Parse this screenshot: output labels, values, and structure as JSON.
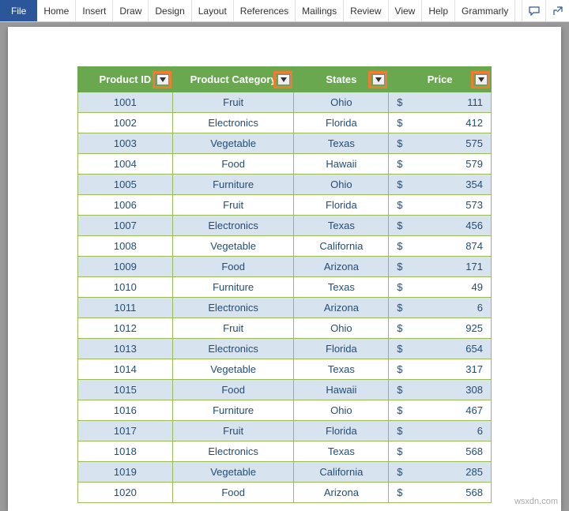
{
  "ribbon": {
    "file": "File",
    "tabs": [
      "Home",
      "Insert",
      "Draw",
      "Design",
      "Layout",
      "References",
      "Mailings",
      "Review",
      "View",
      "Help",
      "Grammarly"
    ],
    "comment_icon": "💬",
    "share_icon": "↗"
  },
  "table": {
    "headers": [
      "Product ID",
      "Product Category",
      "States",
      "Price"
    ],
    "currency": "$",
    "rows": [
      {
        "id": "1001",
        "cat": "Fruit",
        "state": "Ohio",
        "price": "111"
      },
      {
        "id": "1002",
        "cat": "Electronics",
        "state": "Florida",
        "price": "412"
      },
      {
        "id": "1003",
        "cat": "Vegetable",
        "state": "Texas",
        "price": "575"
      },
      {
        "id": "1004",
        "cat": "Food",
        "state": "Hawaii",
        "price": "579"
      },
      {
        "id": "1005",
        "cat": "Furniture",
        "state": "Ohio",
        "price": "354"
      },
      {
        "id": "1006",
        "cat": "Fruit",
        "state": "Florida",
        "price": "573"
      },
      {
        "id": "1007",
        "cat": "Electronics",
        "state": "Texas",
        "price": "456"
      },
      {
        "id": "1008",
        "cat": "Vegetable",
        "state": "California",
        "price": "874"
      },
      {
        "id": "1009",
        "cat": "Food",
        "state": "Arizona",
        "price": "171"
      },
      {
        "id": "1010",
        "cat": "Furniture",
        "state": "Texas",
        "price": "49"
      },
      {
        "id": "1011",
        "cat": "Electronics",
        "state": "Arizona",
        "price": "6"
      },
      {
        "id": "1012",
        "cat": "Fruit",
        "state": "Ohio",
        "price": "925"
      },
      {
        "id": "1013",
        "cat": "Electronics",
        "state": "Florida",
        "price": "654"
      },
      {
        "id": "1014",
        "cat": "Vegetable",
        "state": "Texas",
        "price": "317"
      },
      {
        "id": "1015",
        "cat": "Food",
        "state": "Hawaii",
        "price": "308"
      },
      {
        "id": "1016",
        "cat": "Furniture",
        "state": "Ohio",
        "price": "467"
      },
      {
        "id": "1017",
        "cat": "Fruit",
        "state": "Florida",
        "price": "6"
      },
      {
        "id": "1018",
        "cat": "Electronics",
        "state": "Texas",
        "price": "568"
      },
      {
        "id": "1019",
        "cat": "Vegetable",
        "state": "California",
        "price": "285"
      },
      {
        "id": "1020",
        "cat": "Food",
        "state": "Arizona",
        "price": "568"
      }
    ]
  },
  "watermark": "wsxdn.com"
}
